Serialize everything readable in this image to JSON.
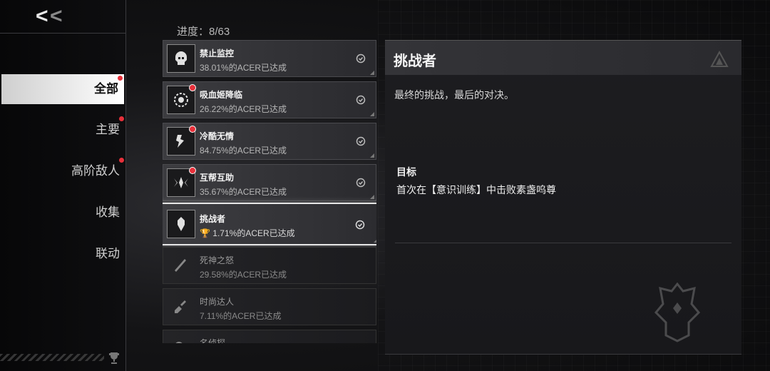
{
  "nav": {
    "back_label": "<<",
    "items": [
      {
        "label": "全部",
        "active": true,
        "badge": true
      },
      {
        "label": "主要",
        "active": false,
        "badge": true
      },
      {
        "label": "高阶敌人",
        "active": false,
        "badge": true
      },
      {
        "label": "收集",
        "active": false,
        "badge": false
      },
      {
        "label": "联动",
        "active": false,
        "badge": false
      }
    ]
  },
  "progress": {
    "label": "进度：8/63"
  },
  "achievements": [
    {
      "name": "禁止监控",
      "rate": "38.01%的ACER已达成",
      "icon": "skull-mask-icon",
      "completed": true,
      "badge": false
    },
    {
      "name": "吸血姬降临",
      "rate": "26.22%的ACER已达成",
      "icon": "gear-crest-icon",
      "completed": true,
      "badge": true
    },
    {
      "name": "冷酷无情",
      "rate": "84.75%的ACER已达成",
      "icon": "blade-helmet-icon",
      "completed": true,
      "badge": true
    },
    {
      "name": "互帮互助",
      "rate": "35.67%的ACER已达成",
      "icon": "wings-crest-icon",
      "completed": true,
      "badge": true
    },
    {
      "name": "挑战者",
      "rate": "1.71%的ACER已达成",
      "icon": "knight-mask-icon",
      "completed": true,
      "badge": false,
      "selected": true,
      "trophy": true
    },
    {
      "name": "死神之怒",
      "rate": "29.58%的ACER已达成",
      "icon": "scythe-blade-icon",
      "completed": false,
      "badge": false
    },
    {
      "name": "时尚达人",
      "rate": "7.11%的ACER已达成",
      "icon": "brush-icon",
      "completed": false,
      "badge": false
    },
    {
      "name": "名侦探",
      "rate": "",
      "icon": "detective-icon",
      "completed": false,
      "badge": false
    }
  ],
  "detail": {
    "title": "挑战者",
    "description": "最终的挑战，最后的对决。",
    "objective_label": "目标",
    "objective_text": "首次在【意识训练】中击败素盏呜尊"
  },
  "colors": {
    "accent_red": "#e8303a",
    "selected_border": "#e6e6e6"
  }
}
